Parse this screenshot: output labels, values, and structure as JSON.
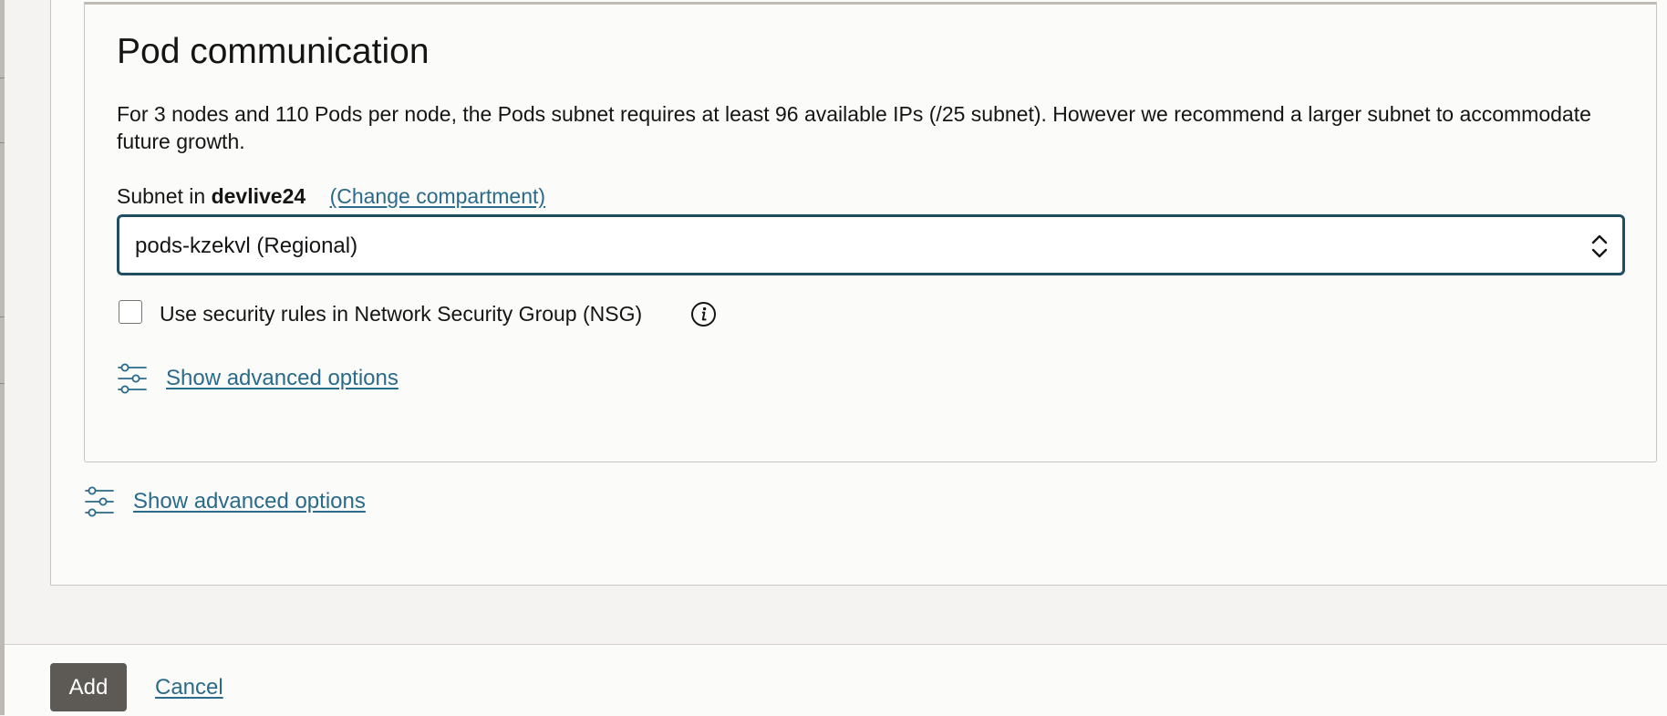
{
  "pod_communication": {
    "title": "Pod communication",
    "description": "For 3 nodes and 110 Pods per node, the Pods subnet requires at least 96 available IPs (/25 subnet). However we recommend a larger subnet to accommodate future growth.",
    "subnet_label_prefix": "Subnet in",
    "compartment_name": "devlive24",
    "change_compartment_label": "(Change compartment)",
    "subnet_select": {
      "selected_value": "pods-kzekvl (Regional)"
    },
    "nsg_checkbox": {
      "label": "Use security rules in Network Security Group (NSG)",
      "checked": false
    },
    "advanced_options_label": "Show advanced options"
  },
  "outer_section": {
    "advanced_options_label": "Show advanced options"
  },
  "footer": {
    "add_label": "Add",
    "cancel_label": "Cancel"
  },
  "colors": {
    "link": "#2a6a8a",
    "select_border": "#1f4e62",
    "primary_button": "#5d5955"
  },
  "icons": {
    "advanced_options": "sliders-icon",
    "nsg_info": "info-icon",
    "select_toggle": "chevron-up-down-icon"
  }
}
